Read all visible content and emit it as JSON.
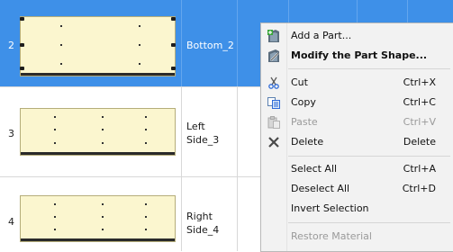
{
  "rows": [
    {
      "index": "2",
      "name_lines": [
        "Bottom_2"
      ],
      "selected": true
    },
    {
      "index": "3",
      "name_lines": [
        "Left",
        "Side_3"
      ],
      "selected": false
    },
    {
      "index": "4",
      "name_lines": [
        "Right",
        "Side_4"
      ],
      "selected": false
    }
  ],
  "menu": {
    "items": [
      {
        "label": "Add a Part...",
        "shortcut": "",
        "icon": "add-part-icon",
        "bold": false,
        "disabled": false
      },
      {
        "label": "Modify the Part Shape...",
        "shortcut": "",
        "icon": "modify-shape-icon",
        "bold": true,
        "disabled": false
      },
      {
        "label": "Cut",
        "shortcut": "Ctrl+X",
        "icon": "scissors-icon",
        "bold": false,
        "disabled": false
      },
      {
        "label": "Copy",
        "shortcut": "Ctrl+C",
        "icon": "copy-icon",
        "bold": false,
        "disabled": false
      },
      {
        "label": "Paste",
        "shortcut": "Ctrl+V",
        "icon": "paste-icon",
        "bold": false,
        "disabled": true
      },
      {
        "label": "Delete",
        "shortcut": "Delete",
        "icon": "delete-x-icon",
        "bold": false,
        "disabled": false
      },
      {
        "label": "Select All",
        "shortcut": "Ctrl+A",
        "icon": "",
        "bold": false,
        "disabled": false
      },
      {
        "label": "Deselect All",
        "shortcut": "Ctrl+D",
        "icon": "",
        "bold": false,
        "disabled": false
      },
      {
        "label": "Invert Selection",
        "shortcut": "",
        "icon": "",
        "bold": false,
        "disabled": false
      },
      {
        "label": "Restore Material",
        "shortcut": "",
        "icon": "",
        "bold": false,
        "disabled": true
      }
    ]
  },
  "colors": {
    "selection": "#3e90e8",
    "thumbnail_fill": "#fbf6cf",
    "menu_bg": "#f2f2f2",
    "disabled_text": "#9a9a9a"
  }
}
